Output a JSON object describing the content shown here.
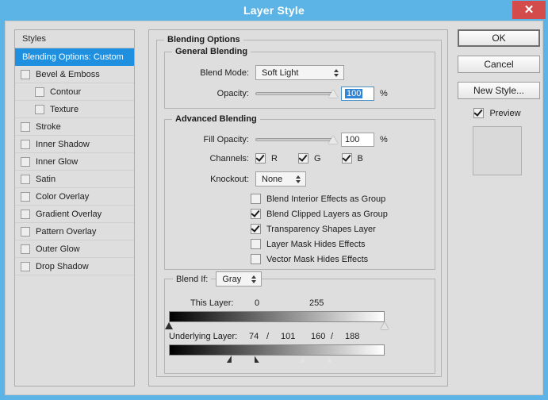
{
  "window": {
    "title": "Layer Style",
    "close_icon": "close-icon",
    "accent_color": "#5bb4e5",
    "close_color": "#d44b4b",
    "dialog_bg": "#dedede",
    "selection_color": "#1f8fe0"
  },
  "styles_panel": {
    "header": "Styles",
    "items": [
      {
        "label": "Blending Options: Custom",
        "selected": true,
        "checkbox": false,
        "indent": false
      },
      {
        "label": "Bevel & Emboss",
        "selected": false,
        "checkbox": true,
        "checked": false,
        "indent": false
      },
      {
        "label": "Contour",
        "selected": false,
        "checkbox": true,
        "checked": false,
        "indent": true
      },
      {
        "label": "Texture",
        "selected": false,
        "checkbox": true,
        "checked": false,
        "indent": true
      },
      {
        "label": "Stroke",
        "selected": false,
        "checkbox": true,
        "checked": false,
        "indent": false
      },
      {
        "label": "Inner Shadow",
        "selected": false,
        "checkbox": true,
        "checked": false,
        "indent": false
      },
      {
        "label": "Inner Glow",
        "selected": false,
        "checkbox": true,
        "checked": false,
        "indent": false
      },
      {
        "label": "Satin",
        "selected": false,
        "checkbox": true,
        "checked": false,
        "indent": false
      },
      {
        "label": "Color Overlay",
        "selected": false,
        "checkbox": true,
        "checked": false,
        "indent": false
      },
      {
        "label": "Gradient Overlay",
        "selected": false,
        "checkbox": true,
        "checked": false,
        "indent": false
      },
      {
        "label": "Pattern Overlay",
        "selected": false,
        "checkbox": true,
        "checked": false,
        "indent": false
      },
      {
        "label": "Outer Glow",
        "selected": false,
        "checkbox": true,
        "checked": false,
        "indent": false
      },
      {
        "label": "Drop Shadow",
        "selected": false,
        "checkbox": true,
        "checked": false,
        "indent": false
      }
    ]
  },
  "options": {
    "group_title": "Blending Options",
    "general": {
      "title": "General Blending",
      "blend_mode_label": "Blend Mode:",
      "blend_mode_value": "Soft Light",
      "opacity_label": "Opacity:",
      "opacity_value": "100",
      "opacity_percent": "%",
      "opacity_slider_pct": 100
    },
    "advanced": {
      "title": "Advanced Blending",
      "fill_opacity_label": "Fill Opacity:",
      "fill_opacity_value": "100",
      "fill_opacity_percent": "%",
      "fill_opacity_slider_pct": 100,
      "channels_label": "Channels:",
      "channels": [
        {
          "label": "R",
          "checked": true
        },
        {
          "label": "G",
          "checked": true
        },
        {
          "label": "B",
          "checked": true
        }
      ],
      "knockout_label": "Knockout:",
      "knockout_value": "None",
      "checkboxes": [
        {
          "label": "Blend Interior Effects as Group",
          "checked": false
        },
        {
          "label": "Blend Clipped Layers as Group",
          "checked": true
        },
        {
          "label": "Transparency Shapes Layer",
          "checked": true
        },
        {
          "label": "Layer Mask Hides Effects",
          "checked": false
        },
        {
          "label": "Vector Mask Hides Effects",
          "checked": false
        }
      ]
    },
    "blend_if": {
      "label": "Blend If:",
      "channel_value": "Gray",
      "this_layer": {
        "label": "This Layer:",
        "black_value": "0",
        "white_value": "255",
        "black_pos_pct": 0,
        "white_pos_pct": 100
      },
      "underlying_layer": {
        "label": "Underlying Layer:",
        "black_low": "74",
        "black_high": "101",
        "white_low": "160",
        "white_high": "188",
        "separator": "/",
        "black_low_pct": 29,
        "black_high_pct": 39.6,
        "white_low_pct": 62.7,
        "white_high_pct": 73.7
      }
    }
  },
  "buttons": {
    "ok": "OK",
    "cancel": "Cancel",
    "new_style": "New Style...",
    "preview_label": "Preview",
    "preview_checked": true
  }
}
